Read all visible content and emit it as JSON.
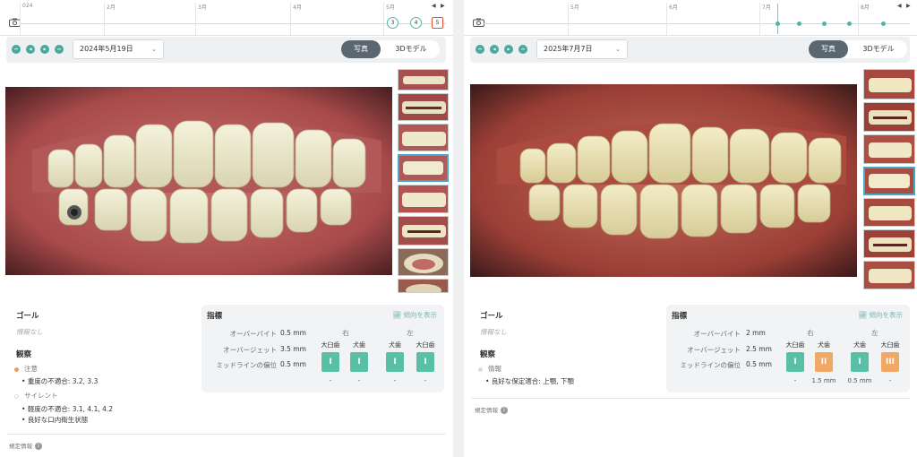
{
  "colors": {
    "accent": "#55b3a3",
    "class_green": "#59bfa5",
    "class_orange": "#f0a964",
    "selected_node": "#e0522e",
    "caution": "#e8a05a"
  },
  "panels": [
    {
      "timeline": {
        "months": [
          "024",
          "2月",
          "3月",
          "4月",
          "5月"
        ],
        "nodes": [
          "3",
          "4",
          "5"
        ],
        "selected_node": "5"
      },
      "date": "2024年5月19日",
      "view": {
        "photo": "写真",
        "model": "3Dモデル",
        "active": "photo"
      },
      "goal": {
        "heading": "ゴール",
        "value": "情報なし"
      },
      "observations": {
        "heading": "観察",
        "groups": [
          {
            "label": "注意",
            "status": "caution",
            "items": [
              "重度の不適合: 3.2, 3.3"
            ]
          },
          {
            "label": "サイレント",
            "status": "silent",
            "items": [
              "軽度の不適合: 3.1, 4.1, 4.2",
              "良好な口内衛生状態"
            ]
          }
        ]
      },
      "metrics": {
        "heading": "指標",
        "trend": "傾向を表示",
        "rows": [
          {
            "label": "オーバーバイト",
            "value": "0.5 mm"
          },
          {
            "label": "オーバージェット",
            "value": "3.5 mm"
          },
          {
            "label": "ミッドラインの偏位",
            "value": "0.5 mm"
          }
        ],
        "side_right": "右",
        "side_left": "左",
        "teeth": [
          {
            "name": "大臼歯",
            "cls": "I",
            "color": "green",
            "delta": "-"
          },
          {
            "name": "犬歯",
            "cls": "I",
            "color": "green",
            "delta": "-"
          },
          {
            "name": "犬歯",
            "cls": "I",
            "color": "green",
            "delta": "-"
          },
          {
            "name": "大臼歯",
            "cls": "I",
            "color": "green",
            "delta": "-"
          }
        ]
      },
      "footer": "規定情報"
    },
    {
      "timeline": {
        "months": [
          "5月",
          "6月",
          "7月",
          "8月"
        ],
        "nodes": [],
        "selected_node": ""
      },
      "date": "2025年7月7日",
      "view": {
        "photo": "写真",
        "model": "3Dモデル",
        "active": "photo"
      },
      "goal": {
        "heading": "ゴール",
        "value": "情報なし"
      },
      "observations": {
        "heading": "観察",
        "groups": [
          {
            "label": "情報",
            "status": "info",
            "items": [
              "良好な保定適合: 上顎, 下顎"
            ]
          }
        ]
      },
      "metrics": {
        "heading": "指標",
        "trend": "傾向を表示",
        "rows": [
          {
            "label": "オーバーバイト",
            "value": "2 mm"
          },
          {
            "label": "オーバージェット",
            "value": "2.5 mm"
          },
          {
            "label": "ミッドラインの偏位",
            "value": "0.5 mm"
          }
        ],
        "side_right": "右",
        "side_left": "左",
        "teeth": [
          {
            "name": "大臼歯",
            "cls": "I",
            "color": "green",
            "delta": "-"
          },
          {
            "name": "犬歯",
            "cls": "II",
            "color": "orange",
            "delta": "1.5 mm"
          },
          {
            "name": "犬歯",
            "cls": "I",
            "color": "green",
            "delta": "0.5 mm"
          },
          {
            "name": "大臼歯",
            "cls": "III",
            "color": "orange",
            "delta": "-"
          }
        ]
      },
      "footer": "規定情報"
    }
  ]
}
